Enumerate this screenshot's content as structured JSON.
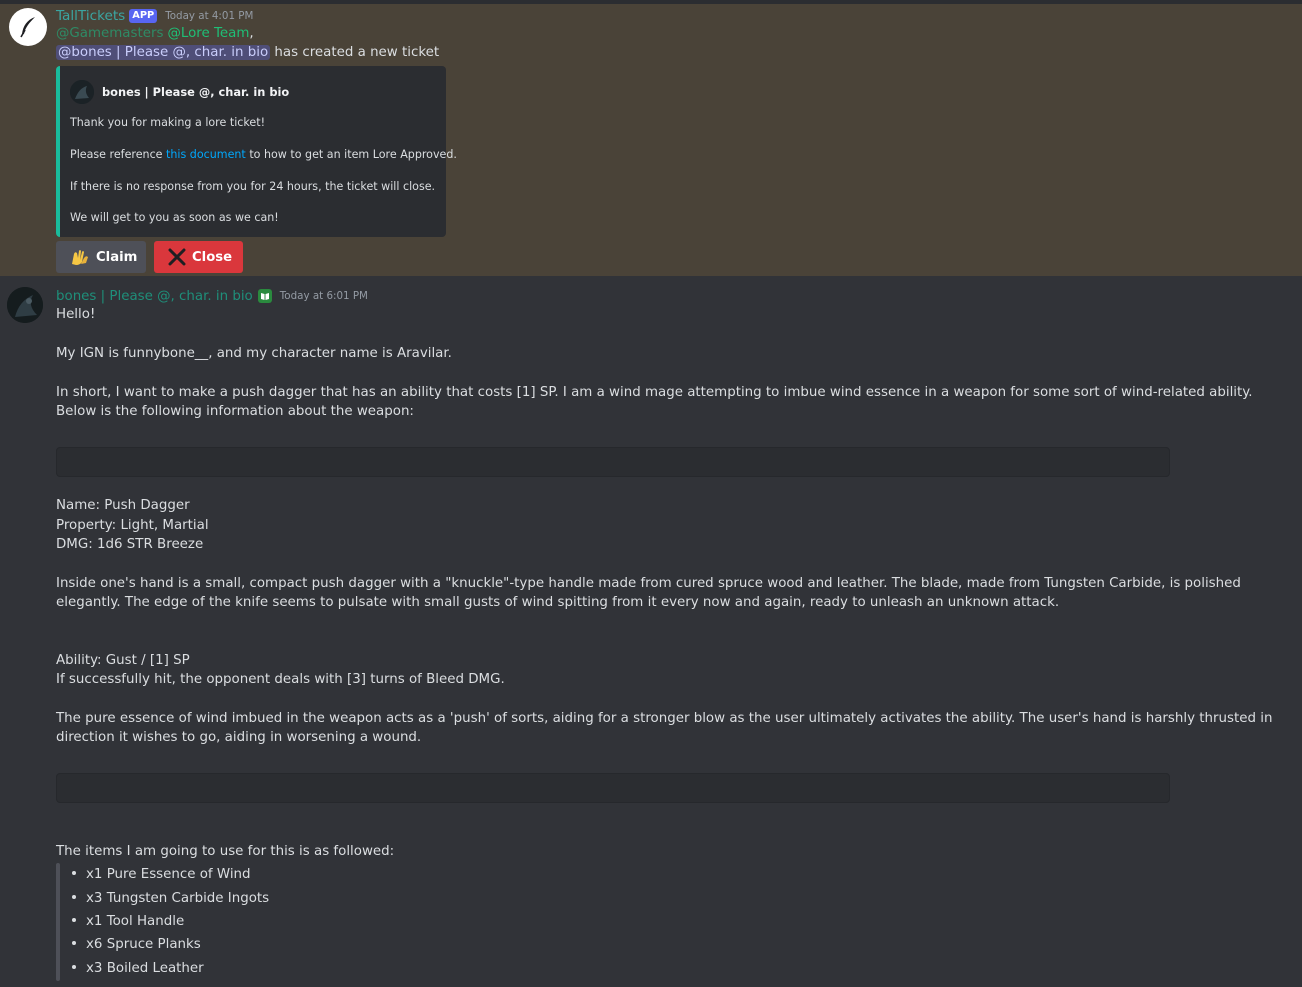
{
  "message1": {
    "author": "TallTickets",
    "badge": "APP",
    "timestamp": "Today at 4:01 PM",
    "mention_gamemasters": "@Gamemasters",
    "mention_lore": "@Lore Team",
    "mention_sep": ",",
    "mention_user": "@bones | Please @, char. in bio",
    "line_text": "has created a new ticket",
    "embed": {
      "author": "bones | Please @, char. in bio",
      "line1": "Thank you for making a lore ticket!",
      "line2_before": "Please reference",
      "line2_link": "this document",
      "line2_after": "to how to get an item Lore Approved.",
      "line3": "If there is no response from you for 24 hours, the ticket will close.",
      "line4": "We will get to you as soon as we can!",
      "accent_color": "#1abc9c"
    },
    "buttons": {
      "claim": "Claim",
      "close": "Close"
    }
  },
  "message2": {
    "author": "bones | Please @, char. in bio",
    "timestamp": "Today at 6:01 PM",
    "p1": "Hello!",
    "p2": "My IGN is funnybone__, and my character name is Aravilar.",
    "p3": "In short, I want to make a push dagger that has an ability that costs [1] SP. I am a wind mage attempting to imbue wind essence in a weapon for some sort of wind-related ability. Below is the following information about the weapon:",
    "name_line": "Name: Push Dagger",
    "property_line": "Property: Light, Martial",
    "dmg_line": "DMG: 1d6 STR Breeze",
    "desc": "Inside one's hand is a small, compact push dagger with a \"knuckle\"-type handle made from cured spruce wood and leather. The blade, made from Tungsten Carbide, is polished elegantly. The edge of the knife seems to pulsate with small gusts of wind spitting from it every now and again, ready to unleash an unknown attack.",
    "ability_line": "Ability: Gust / [1] SP",
    "ability_effect": "If successfully hit, the opponent deals with [3] turns of Bleed DMG.",
    "ability_desc": "The pure essence of wind imbued in the weapon acts as a 'push' of sorts, aiding for a stronger blow as the user ultimately activates the ability. The user's hand is harshly thrusted in direction it wishes to go, aiding in worsening a wound.",
    "items_intro": "The items I am going to use for this is as followed:",
    "items": [
      "x1 Pure Essence of Wind",
      "x3 Tungsten Carbide Ingots",
      "x1 Tool Handle",
      "x6 Spruce Planks",
      "x3 Boiled Leather"
    ]
  },
  "colors": {
    "background": "#313338",
    "highlight": "#4a4338",
    "close_button": "#da373c",
    "claim_button": "#4e5058",
    "link": "#00a8fc"
  }
}
